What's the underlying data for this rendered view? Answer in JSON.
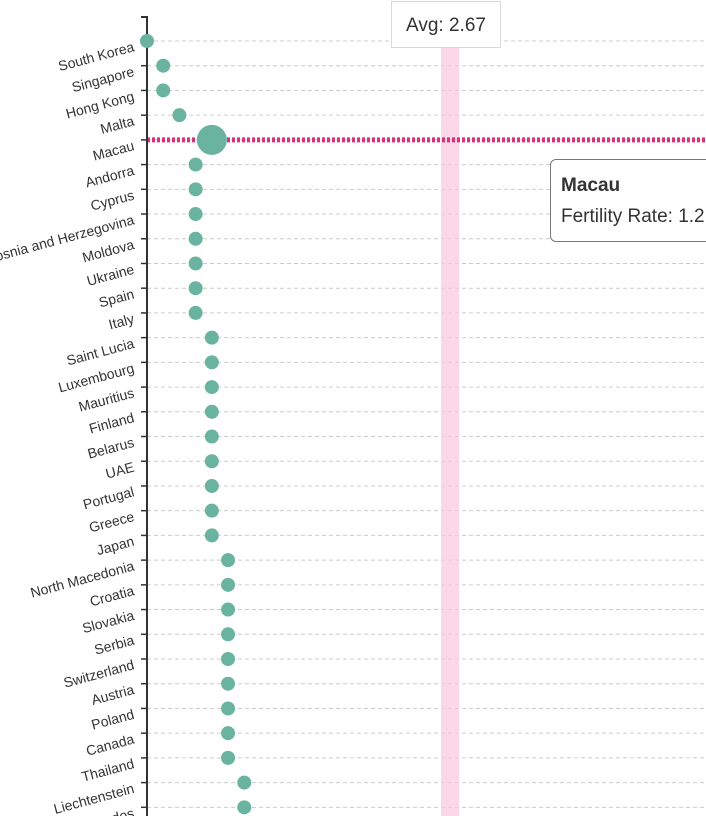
{
  "chart_data": {
    "type": "scatter",
    "orientation": "horizontal-dot-plot",
    "categories": [
      "South Korea",
      "Singapore",
      "Hong Kong",
      "Malta",
      "Macau",
      "Andorra",
      "Cyprus",
      "Bosnia and Herzegovina",
      "Moldova",
      "Ukraine",
      "Spain",
      "Italy",
      "Saint Lucia",
      "Luxembourg",
      "Mauritius",
      "Finland",
      "Belarus",
      "UAE",
      "Portugal",
      "Greece",
      "Japan",
      "North Macedonia",
      "Croatia",
      "Slovakia",
      "Serbia",
      "Switzerland",
      "Austria",
      "Poland",
      "Canada",
      "Thailand",
      "Liechtenstein",
      "Barbados"
    ],
    "values": [
      0.8,
      0.9,
      0.9,
      1.0,
      1.2,
      1.1,
      1.1,
      1.1,
      1.1,
      1.1,
      1.1,
      1.1,
      1.2,
      1.2,
      1.2,
      1.2,
      1.2,
      1.2,
      1.2,
      1.2,
      1.2,
      1.3,
      1.3,
      1.3,
      1.3,
      1.3,
      1.3,
      1.3,
      1.3,
      1.3,
      1.4,
      1.4
    ],
    "xlim": [
      0.8,
      2.7
    ],
    "average": 2.67,
    "average_label": "Avg: 2.67",
    "highlighted": "Macau",
    "grid": "horizontal dashed",
    "colors": {
      "point": "#6ab3a0",
      "highlight_line": "#d6337f",
      "average_band": "#f9c6dd",
      "grid": "#cccccc",
      "axis": "#333333"
    }
  },
  "tooltip": {
    "title": "Macau",
    "body": "Fertility Rate: 1.2"
  }
}
